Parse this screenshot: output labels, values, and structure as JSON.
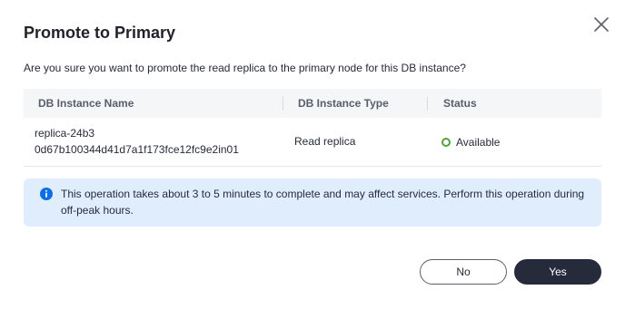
{
  "dialog": {
    "title": "Promote to Primary",
    "question": "Are you sure you want to promote the read replica to the primary node for this DB instance?"
  },
  "table": {
    "columns": [
      "DB Instance Name",
      "DB Instance Type",
      "Status"
    ],
    "rows": [
      {
        "name": "replica-24b3",
        "id": "0d67b100344d41d7a1f173fce12fc9e2in01",
        "type": "Read replica",
        "status": "Available",
        "status_color": "#50a339"
      }
    ]
  },
  "notice": {
    "icon": "info-icon",
    "text": "This operation takes about 3 to 5 minutes to complete and may affect services. Perform this operation during off-peak hours."
  },
  "buttons": {
    "no_label": "No",
    "yes_label": "Yes"
  }
}
